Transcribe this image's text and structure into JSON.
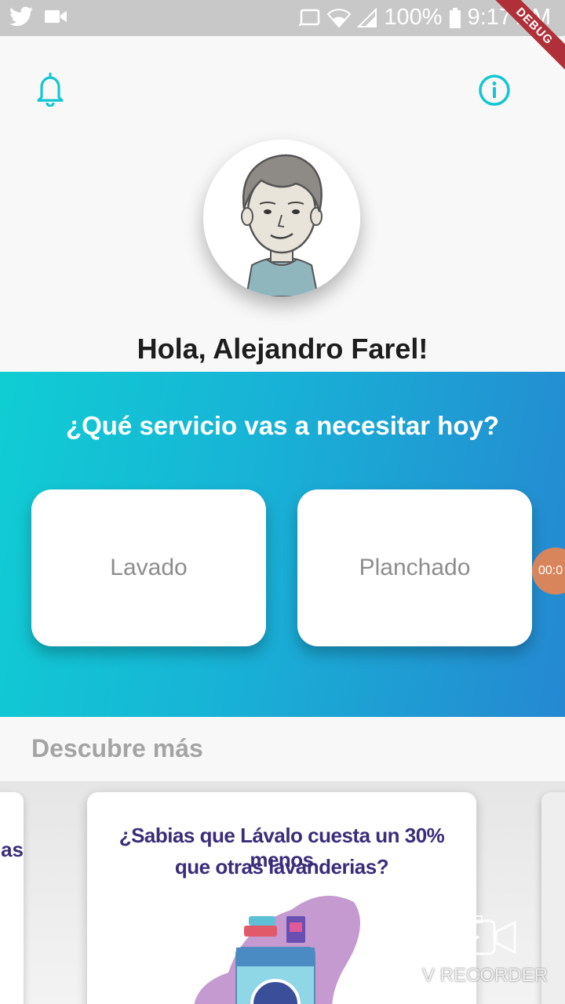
{
  "status_bar": {
    "battery": "100%",
    "time": "9:17 AM",
    "icons": [
      "twitter-icon",
      "video-icon",
      "cast-icon",
      "wifi-icon",
      "signal-icon",
      "battery-icon"
    ]
  },
  "debug_banner": "DEBUG",
  "header": {
    "greeting": "Hola, Alejandro Farel!"
  },
  "hero": {
    "question": "¿Qué servicio vas a necesitar hoy?",
    "services": [
      {
        "label": "Lavado"
      },
      {
        "label": "Planchado"
      }
    ],
    "recorder_timer": "00:0"
  },
  "discover": {
    "title": "Descubre más",
    "prev_card_fragment": "ias",
    "card": {
      "line1": "¿Sabias que Lávalo cuesta un 30% menos",
      "line2": "que otras lavanderias?"
    }
  },
  "watermark": "V RECORDER",
  "colors": {
    "accent": "#12c6d3",
    "gradient_start": "#10cdd3",
    "gradient_end": "#2588d1",
    "promo_text": "#3b2d7a",
    "promo_blob": "#c49ad0"
  }
}
